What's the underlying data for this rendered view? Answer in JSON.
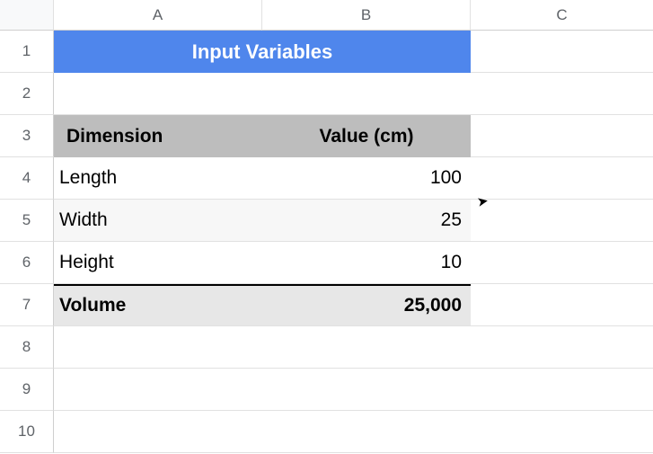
{
  "columns": [
    "A",
    "B",
    "C"
  ],
  "rows": [
    "1",
    "2",
    "3",
    "4",
    "5",
    "6",
    "7",
    "8",
    "9",
    "10"
  ],
  "title": "Input Variables",
  "head": {
    "a": "Dimension",
    "b": "Value (cm)"
  },
  "data": [
    {
      "label": "Length",
      "value": "100"
    },
    {
      "label": "Width",
      "value": "25"
    },
    {
      "label": "Height",
      "value": "10"
    }
  ],
  "summary": {
    "label": "Volume",
    "value": "25,000"
  },
  "chart_data": {
    "type": "table",
    "title": "Input Variables",
    "columns": [
      "Dimension",
      "Value (cm)"
    ],
    "rows": [
      [
        "Length",
        100
      ],
      [
        "Width",
        25
      ],
      [
        "Height",
        10
      ],
      [
        "Volume",
        25000
      ]
    ]
  }
}
